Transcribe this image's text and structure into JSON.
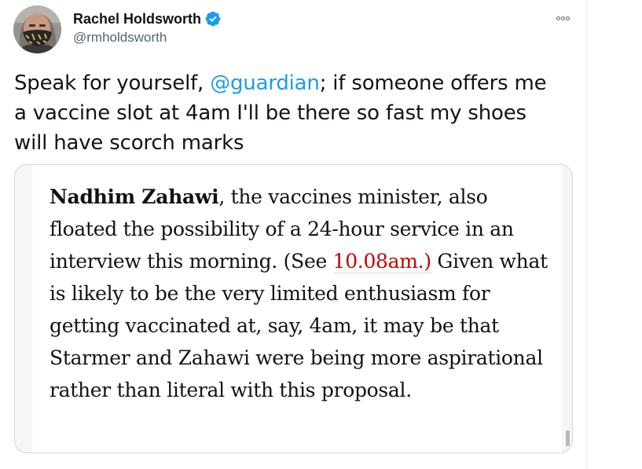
{
  "author": {
    "display_name": "Rachel Holdsworth",
    "handle": "@rmholdsworth",
    "verified_icon": "verified-badge-icon",
    "verified_color": "#1d9bf0"
  },
  "more_icon": "more-options-icon",
  "tweet": {
    "text_before": "Speak for yourself, ",
    "mention": "@guardian",
    "text_after": "; if someone offers me a vaccine slot at 4am I'll be there so fast my shoes will have scorch marks"
  },
  "media": {
    "strong": "Nadhim Zahawi",
    "part1": ", the vaccines minister, also floated the possibility of a 24-hour service in an interview this morning. (See ",
    "link": "10.08am.)",
    "part2": " Given what is likely to be the very limited enthusiasm for getting vaccinated at, say, 4am, it may be that Starmer and Zahawi were being more aspirational rather than literal with this proposal.",
    "link_color": "#c70000"
  },
  "colors": {
    "text": "#0f1419",
    "secondary": "#536471",
    "accent": "#1d9bf0",
    "border": "#cfd9de"
  }
}
